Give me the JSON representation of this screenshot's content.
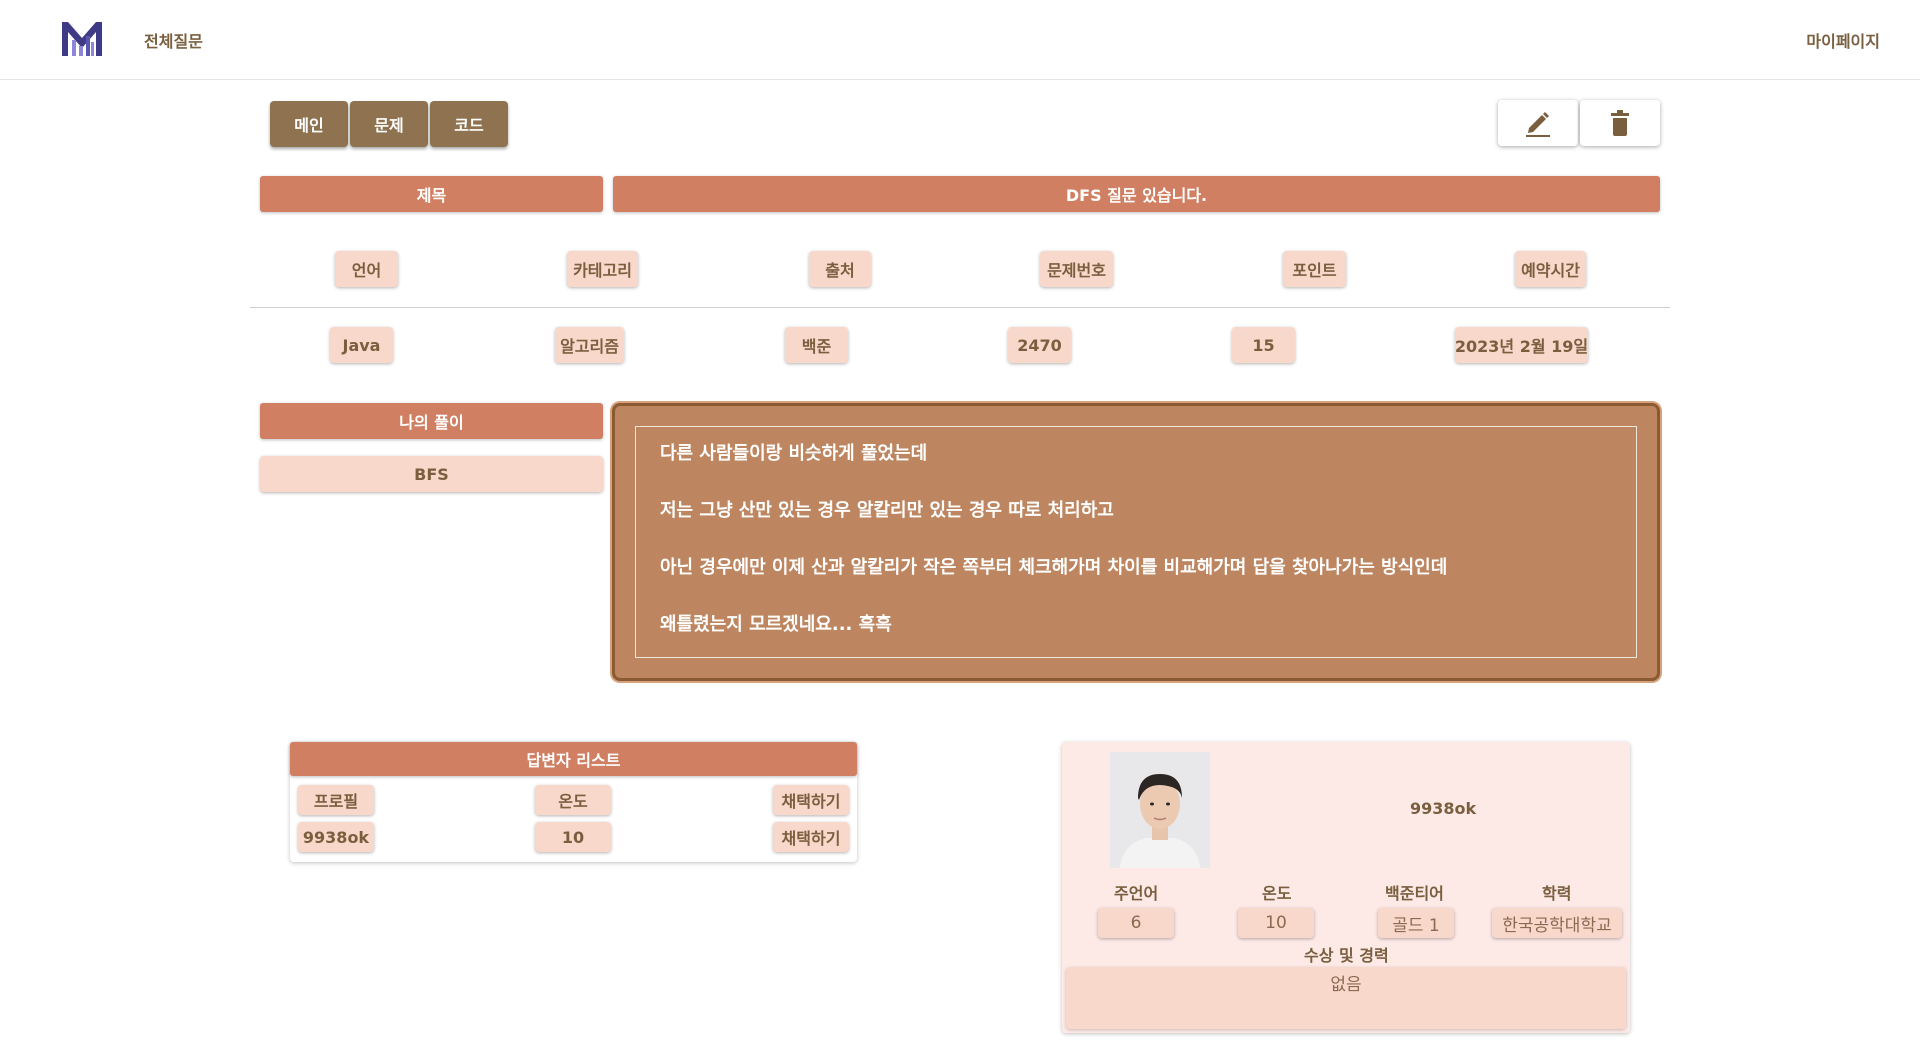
{
  "header": {
    "nav_all": "전체질문",
    "nav_mypage": "마이페이지"
  },
  "tabs": [
    "메인",
    "문제",
    "코드"
  ],
  "icons": {
    "edit": "pencil-icon",
    "delete": "trash-icon"
  },
  "title": {
    "label": "제목",
    "value": "DFS 질문 있습니다."
  },
  "info": {
    "headers": [
      "언어",
      "카테고리",
      "출처",
      "문제번호",
      "포인트",
      "예약시간"
    ],
    "values": [
      "Java",
      "알고리즘",
      "백준",
      "2470",
      "15",
      "2023년 2월 19일"
    ]
  },
  "solution": {
    "label": "나의 풀이",
    "value": "BFS",
    "lines": [
      "다른 사람들이랑 비슷하게 풀었는데",
      "저는 그냥 산만 있는 경우 알칼리만 있는 경우 따로 처리하고",
      "아닌 경우에만 이제 산과 알칼리가 작은 쪽부터 체크해가며 차이를 비교해가며 답을 찾아나가는 방식인데",
      "왜틀렸는지 모르겠네요...  흑흑"
    ]
  },
  "answerers": {
    "title": "답변자 리스트",
    "headers": [
      "프로필",
      "온도",
      "채택하기"
    ],
    "rows": [
      {
        "profile": "9938ok",
        "temp": "10",
        "action": "채택하기"
      }
    ]
  },
  "profile": {
    "name": "9938ok",
    "labels": [
      "주언어",
      "온도",
      "백준티어",
      "학력"
    ],
    "values": [
      "6",
      "10",
      "골드 1",
      "한국공학대학교"
    ],
    "awards_label": "수상 및 경력",
    "awards_value": "없음"
  },
  "colors": {
    "accent": "#d07f62",
    "tab": "#8f7350",
    "chip": "#f8d8cb",
    "solution_bg": "#bd8660",
    "card_bg": "#fde9e6"
  }
}
